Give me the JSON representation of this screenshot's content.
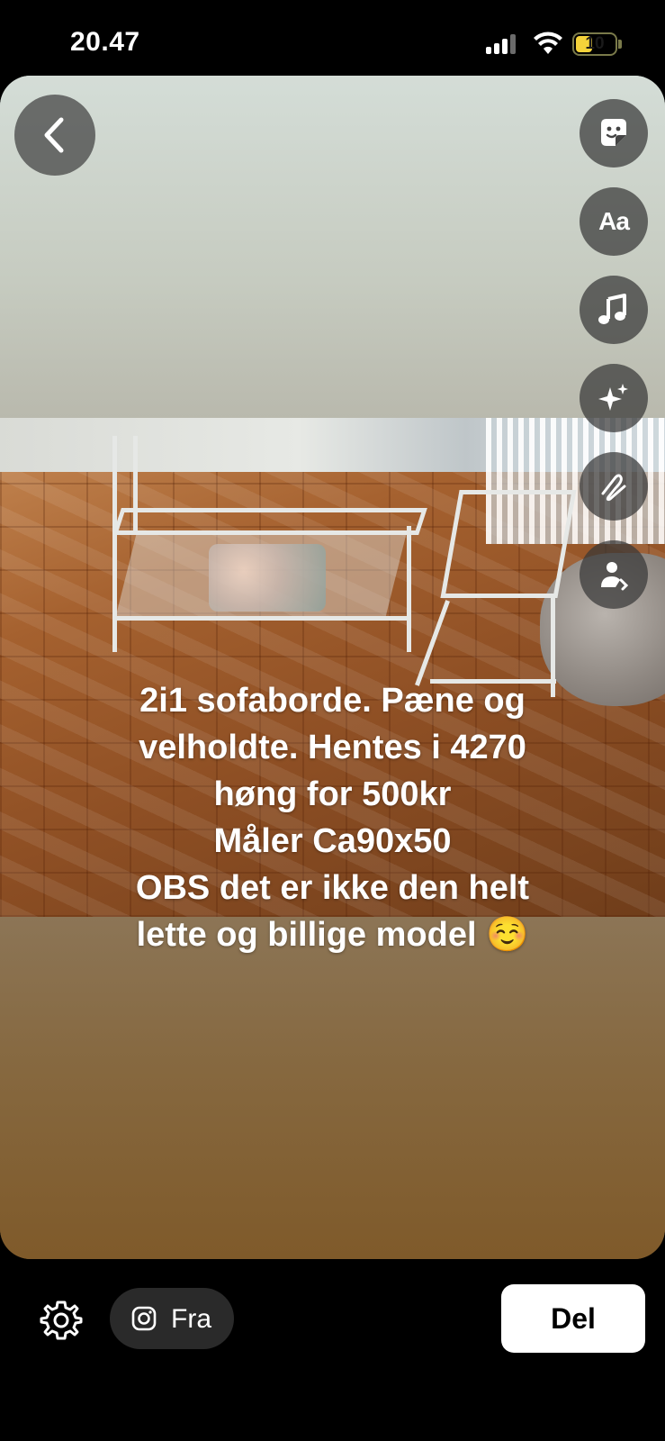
{
  "status_bar": {
    "time": "20.47",
    "battery": "10"
  },
  "story": {
    "caption_lines": [
      "2i1 sofaborde. Pæne og",
      "velholdte. Hentes i 4270",
      "høng for 500kr",
      "Måler Ca90x50",
      "OBS det er ikke den helt",
      "lette og billige model ☺️"
    ]
  },
  "tools": [
    {
      "name": "sticker-icon"
    },
    {
      "name": "text-tool",
      "label": "Aa"
    },
    {
      "name": "music-icon"
    },
    {
      "name": "effects-sparkle-icon"
    },
    {
      "name": "draw-squiggle-icon"
    },
    {
      "name": "mention-person-icon"
    }
  ],
  "bottom_bar": {
    "from_label": "Fra",
    "share_label": "Del"
  },
  "colors": {
    "background": "#000000",
    "share_button_bg": "#ffffff",
    "chip_bg": "#2a2a2a",
    "battery_fill": "#f5d33a"
  }
}
